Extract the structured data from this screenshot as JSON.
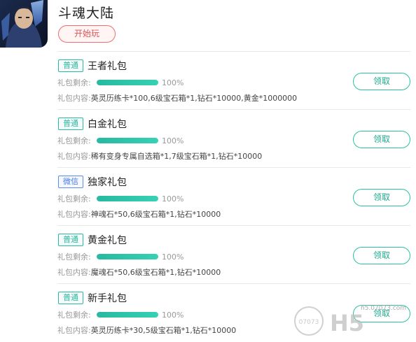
{
  "game": {
    "title": "斗魂大陆",
    "play_label": "开始玩",
    "icon": "game-avatar-icon"
  },
  "gifts": [
    {
      "badge": "普通",
      "badge_type": "normal",
      "name": "王者礼包",
      "remain_label": "礼包剩余:",
      "remain_percent": 100,
      "remain_text": "100%",
      "content_label": "礼包内容:",
      "content": "英灵历练卡*100,6级宝石箱*1,钻石*10000,黄金*1000000",
      "claim_label": "领取"
    },
    {
      "badge": "普通",
      "badge_type": "normal",
      "name": "白金礼包",
      "remain_label": "礼包剩余:",
      "remain_percent": 100,
      "remain_text": "100%",
      "content_label": "礼包内容:",
      "content": "稀有变身专属自选箱*1,7级宝石箱*1,钻石*10000",
      "claim_label": "领取"
    },
    {
      "badge": "微信",
      "badge_type": "wechat",
      "name": "独家礼包",
      "remain_label": "礼包剩余:",
      "remain_percent": 100,
      "remain_text": "100%",
      "content_label": "礼包内容:",
      "content": "神魂石*50,6级宝石箱*1,钻石*10000",
      "claim_label": "领取"
    },
    {
      "badge": "普通",
      "badge_type": "normal",
      "name": "黄金礼包",
      "remain_label": "礼包剩余:",
      "remain_percent": 100,
      "remain_text": "100%",
      "content_label": "礼包内容:",
      "content": "魔魂石*50,6级宝石箱*1,钻石*10000",
      "claim_label": "领取"
    },
    {
      "badge": "普通",
      "badge_type": "normal",
      "name": "新手礼包",
      "remain_label": "礼包剩余:",
      "remain_percent": 100,
      "remain_text": "100%",
      "content_label": "礼包内容:",
      "content": "英灵历练卡*30,5级宝石箱*1,钻石*10000",
      "claim_label": "领取"
    }
  ],
  "watermark": {
    "site": "h5.07073.com",
    "brand": "H5",
    "logo_text": "07073"
  },
  "colors": {
    "accent": "#2bb9a0",
    "play": "#e05252",
    "wechat": "#4a7ee0"
  }
}
